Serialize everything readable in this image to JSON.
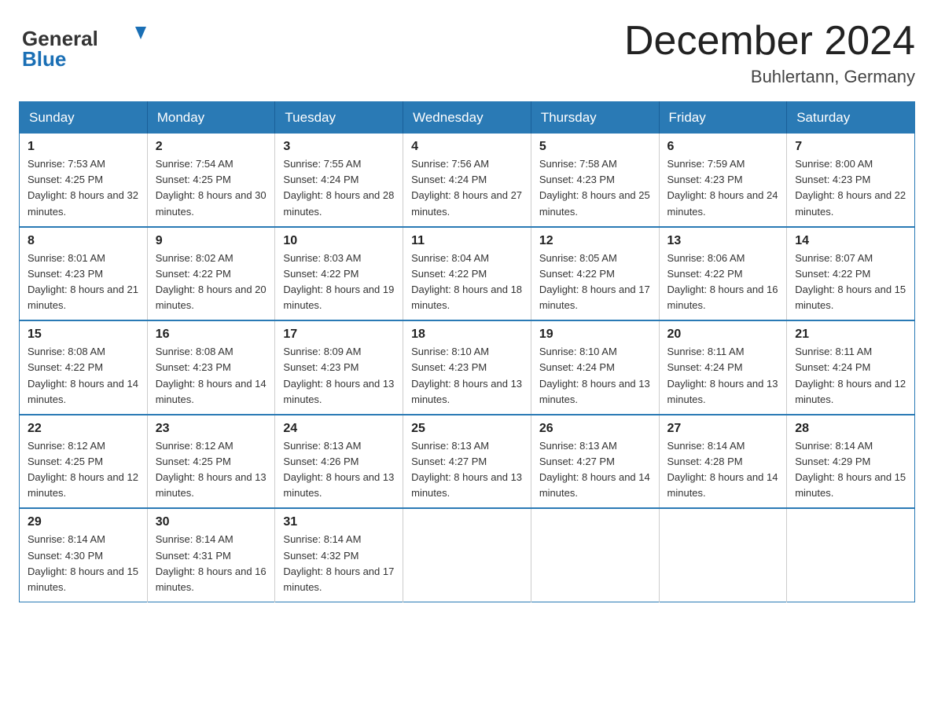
{
  "logo": {
    "line1": "General",
    "arrow": "▶",
    "line2": "Blue"
  },
  "title": {
    "month_year": "December 2024",
    "location": "Buhlertann, Germany"
  },
  "weekdays": [
    "Sunday",
    "Monday",
    "Tuesday",
    "Wednesday",
    "Thursday",
    "Friday",
    "Saturday"
  ],
  "weeks": [
    [
      {
        "day": "1",
        "sunrise": "7:53 AM",
        "sunset": "4:25 PM",
        "daylight": "8 hours and 32 minutes."
      },
      {
        "day": "2",
        "sunrise": "7:54 AM",
        "sunset": "4:25 PM",
        "daylight": "8 hours and 30 minutes."
      },
      {
        "day": "3",
        "sunrise": "7:55 AM",
        "sunset": "4:24 PM",
        "daylight": "8 hours and 28 minutes."
      },
      {
        "day": "4",
        "sunrise": "7:56 AM",
        "sunset": "4:24 PM",
        "daylight": "8 hours and 27 minutes."
      },
      {
        "day": "5",
        "sunrise": "7:58 AM",
        "sunset": "4:23 PM",
        "daylight": "8 hours and 25 minutes."
      },
      {
        "day": "6",
        "sunrise": "7:59 AM",
        "sunset": "4:23 PM",
        "daylight": "8 hours and 24 minutes."
      },
      {
        "day": "7",
        "sunrise": "8:00 AM",
        "sunset": "4:23 PM",
        "daylight": "8 hours and 22 minutes."
      }
    ],
    [
      {
        "day": "8",
        "sunrise": "8:01 AM",
        "sunset": "4:23 PM",
        "daylight": "8 hours and 21 minutes."
      },
      {
        "day": "9",
        "sunrise": "8:02 AM",
        "sunset": "4:22 PM",
        "daylight": "8 hours and 20 minutes."
      },
      {
        "day": "10",
        "sunrise": "8:03 AM",
        "sunset": "4:22 PM",
        "daylight": "8 hours and 19 minutes."
      },
      {
        "day": "11",
        "sunrise": "8:04 AM",
        "sunset": "4:22 PM",
        "daylight": "8 hours and 18 minutes."
      },
      {
        "day": "12",
        "sunrise": "8:05 AM",
        "sunset": "4:22 PM",
        "daylight": "8 hours and 17 minutes."
      },
      {
        "day": "13",
        "sunrise": "8:06 AM",
        "sunset": "4:22 PM",
        "daylight": "8 hours and 16 minutes."
      },
      {
        "day": "14",
        "sunrise": "8:07 AM",
        "sunset": "4:22 PM",
        "daylight": "8 hours and 15 minutes."
      }
    ],
    [
      {
        "day": "15",
        "sunrise": "8:08 AM",
        "sunset": "4:22 PM",
        "daylight": "8 hours and 14 minutes."
      },
      {
        "day": "16",
        "sunrise": "8:08 AM",
        "sunset": "4:23 PM",
        "daylight": "8 hours and 14 minutes."
      },
      {
        "day": "17",
        "sunrise": "8:09 AM",
        "sunset": "4:23 PM",
        "daylight": "8 hours and 13 minutes."
      },
      {
        "day": "18",
        "sunrise": "8:10 AM",
        "sunset": "4:23 PM",
        "daylight": "8 hours and 13 minutes."
      },
      {
        "day": "19",
        "sunrise": "8:10 AM",
        "sunset": "4:24 PM",
        "daylight": "8 hours and 13 minutes."
      },
      {
        "day": "20",
        "sunrise": "8:11 AM",
        "sunset": "4:24 PM",
        "daylight": "8 hours and 13 minutes."
      },
      {
        "day": "21",
        "sunrise": "8:11 AM",
        "sunset": "4:24 PM",
        "daylight": "8 hours and 12 minutes."
      }
    ],
    [
      {
        "day": "22",
        "sunrise": "8:12 AM",
        "sunset": "4:25 PM",
        "daylight": "8 hours and 12 minutes."
      },
      {
        "day": "23",
        "sunrise": "8:12 AM",
        "sunset": "4:25 PM",
        "daylight": "8 hours and 13 minutes."
      },
      {
        "day": "24",
        "sunrise": "8:13 AM",
        "sunset": "4:26 PM",
        "daylight": "8 hours and 13 minutes."
      },
      {
        "day": "25",
        "sunrise": "8:13 AM",
        "sunset": "4:27 PM",
        "daylight": "8 hours and 13 minutes."
      },
      {
        "day": "26",
        "sunrise": "8:13 AM",
        "sunset": "4:27 PM",
        "daylight": "8 hours and 14 minutes."
      },
      {
        "day": "27",
        "sunrise": "8:14 AM",
        "sunset": "4:28 PM",
        "daylight": "8 hours and 14 minutes."
      },
      {
        "day": "28",
        "sunrise": "8:14 AM",
        "sunset": "4:29 PM",
        "daylight": "8 hours and 15 minutes."
      }
    ],
    [
      {
        "day": "29",
        "sunrise": "8:14 AM",
        "sunset": "4:30 PM",
        "daylight": "8 hours and 15 minutes."
      },
      {
        "day": "30",
        "sunrise": "8:14 AM",
        "sunset": "4:31 PM",
        "daylight": "8 hours and 16 minutes."
      },
      {
        "day": "31",
        "sunrise": "8:14 AM",
        "sunset": "4:32 PM",
        "daylight": "8 hours and 17 minutes."
      },
      null,
      null,
      null,
      null
    ]
  ]
}
